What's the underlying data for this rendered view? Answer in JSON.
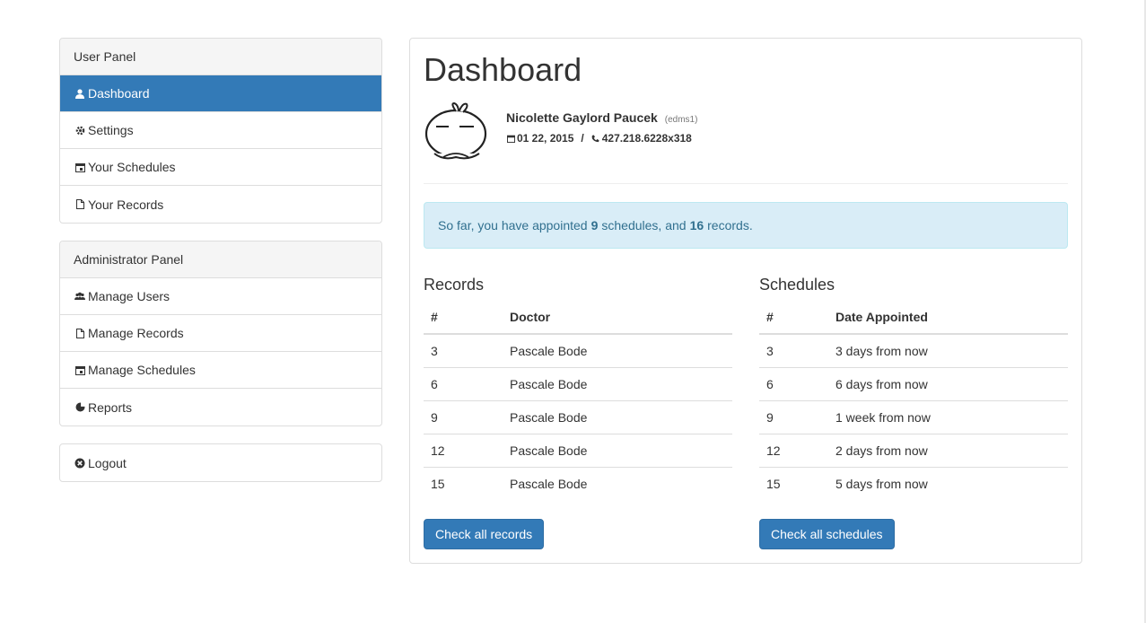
{
  "sidebar": {
    "user_panel": {
      "heading": "User Panel",
      "items": [
        {
          "label": "Dashboard",
          "icon": "user-icon",
          "active": true
        },
        {
          "label": "Settings",
          "icon": "gear-icon"
        },
        {
          "label": "Your Schedules",
          "icon": "calendar-icon"
        },
        {
          "label": "Your Records",
          "icon": "file-icon"
        }
      ]
    },
    "admin_panel": {
      "heading": "Administrator Panel",
      "items": [
        {
          "label": "Manage Users",
          "icon": "users-icon"
        },
        {
          "label": "Manage Records",
          "icon": "file-icon"
        },
        {
          "label": "Manage Schedules",
          "icon": "calendar-icon"
        },
        {
          "label": "Reports",
          "icon": "pie-chart-icon"
        }
      ]
    },
    "logout": {
      "label": "Logout",
      "icon": "close-circle-icon"
    }
  },
  "main": {
    "title": "Dashboard",
    "user": {
      "name": "Nicolette Gaylord Paucek",
      "username": "(edms1)",
      "date": "01 22, 2015",
      "separator": "/",
      "phone": "427.218.6228x318"
    },
    "summary": {
      "prefix": "So far, you have appointed",
      "schedules_count": "9",
      "middle": "schedules, and",
      "records_count": "16",
      "suffix": "records."
    },
    "records": {
      "title": "Records",
      "headers": [
        "#",
        "Doctor"
      ],
      "rows": [
        [
          "3",
          "Pascale Bode"
        ],
        [
          "6",
          "Pascale Bode"
        ],
        [
          "9",
          "Pascale Bode"
        ],
        [
          "12",
          "Pascale Bode"
        ],
        [
          "15",
          "Pascale Bode"
        ]
      ],
      "button": "Check all records"
    },
    "schedules": {
      "title": "Schedules",
      "headers": [
        "#",
        "Date Appointed"
      ],
      "rows": [
        [
          "3",
          "3 days from now"
        ],
        [
          "6",
          "6 days from now"
        ],
        [
          "9",
          "1 week from now"
        ],
        [
          "12",
          "2 days from now"
        ],
        [
          "15",
          "5 days from now"
        ]
      ],
      "button": "Check all schedules"
    }
  },
  "colors": {
    "primary": "#337ab7",
    "alert_bg": "#d9edf7",
    "alert_text": "#31708f"
  }
}
